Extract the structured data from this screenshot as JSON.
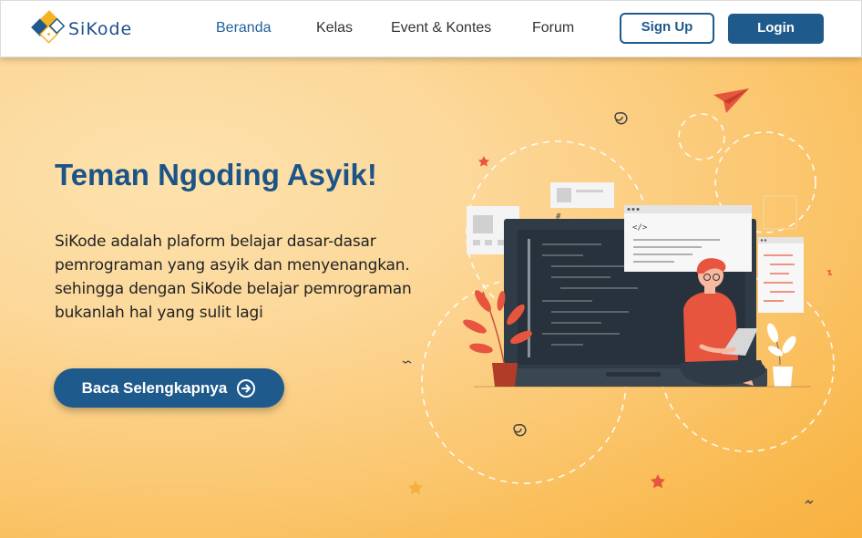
{
  "brand": {
    "name_part1": "Si",
    "name_part2": "Kode"
  },
  "nav": {
    "items": [
      {
        "label": "Beranda",
        "active": true
      },
      {
        "label": "Kelas",
        "active": false
      },
      {
        "label": "Event & Kontes",
        "active": false
      },
      {
        "label": "Forum",
        "active": false
      }
    ],
    "signup_label": "Sign Up",
    "login_label": "Login"
  },
  "hero": {
    "title": "Teman Ngoding Asyik!",
    "description_lines": [
      "SiKode adalah plaform belajar dasar-dasar",
      "pemrograman yang asyik dan menyenangkan.",
      "sehingga dengan SiKode belajar pemrograman",
      "bukanlah hal yang sulit lagi"
    ],
    "cta_label": "Baca Selengkapnya",
    "code_tag": "</>"
  },
  "colors": {
    "primary": "#1f5a8c",
    "active_nav": "#22609e",
    "hero_light": "#fde2ad",
    "hero_dark": "#f8b13f",
    "accent_red": "#e8553e"
  },
  "icons": [
    "logo-diamond-icon",
    "arrow-right-circle-icon",
    "paper-plane-icon",
    "star-icon",
    "spiral-icon"
  ]
}
